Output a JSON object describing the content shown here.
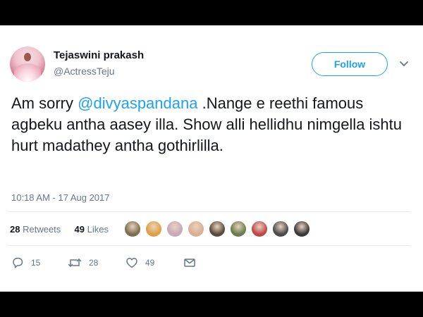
{
  "author": {
    "name": "Tejaswini prakash",
    "handle": "@ActressTeju"
  },
  "follow_label": "Follow",
  "tweet": {
    "prefix": "Am sorry ",
    "mention": "@divyaspandana",
    "suffix": " .Nange e reethi famous agbeku antha aasey illa. Show alli hellidhu nimgella ishtu hurt madathey antha gothirlilla."
  },
  "timestamp": "10:18 AM - 17 Aug 2017",
  "stats": {
    "retweets_count": "28",
    "retweets_label": "Retweets",
    "likes_count": "49",
    "likes_label": "Likes"
  },
  "likers": [
    {
      "color": "#7a6e4f"
    },
    {
      "color": "#e0a040"
    },
    {
      "color": "#c9a8b8"
    },
    {
      "color": "#d8b090"
    },
    {
      "color": "#5a4a3a"
    },
    {
      "color": "#6b7d4a"
    },
    {
      "color": "#c04848"
    },
    {
      "color": "#4a4a4a"
    },
    {
      "color": "#3a3a3a"
    }
  ],
  "actions": {
    "replies": "15",
    "retweets": "28",
    "likes": "49"
  },
  "icons": {
    "reply": "reply-icon",
    "retweet": "retweet-icon",
    "like": "heart-icon",
    "dm": "envelope-icon",
    "more": "chevron-down-icon"
  },
  "colors": {
    "accent": "#1da1f2",
    "text": "#14171a",
    "secondary": "#657786"
  }
}
